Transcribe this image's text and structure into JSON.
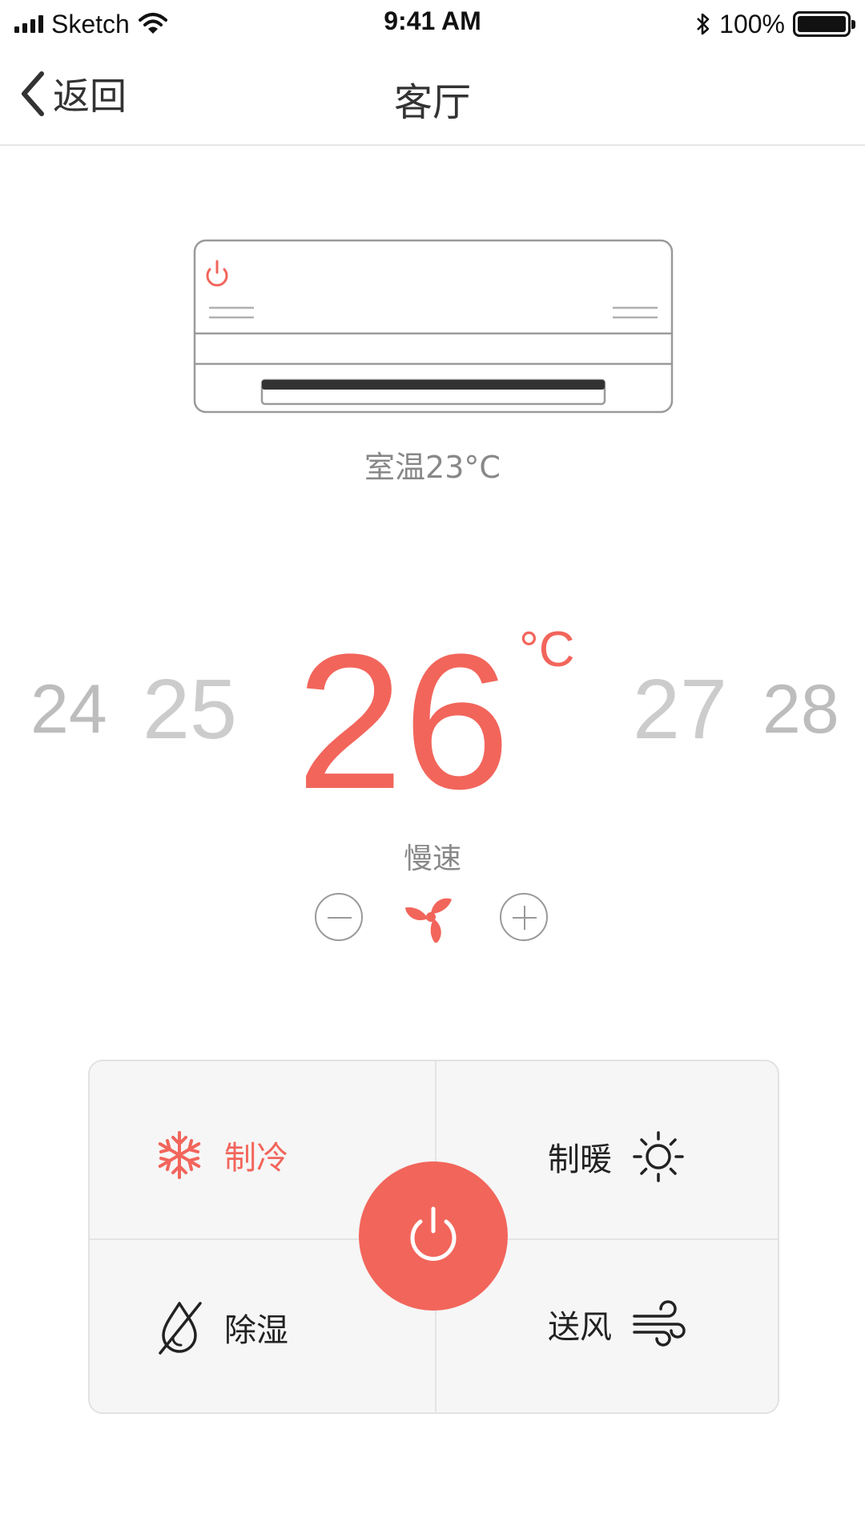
{
  "status_bar": {
    "carrier": "Sketch",
    "time": "9:41 AM",
    "battery": "100%"
  },
  "nav": {
    "back_label": "返回",
    "title": "客厅"
  },
  "room_temperature": "室温23°C",
  "temperature": {
    "options": [
      "24",
      "25",
      "26",
      "27",
      "28"
    ],
    "current": "26",
    "unit": "°C"
  },
  "fan": {
    "speed_label": "慢速"
  },
  "modes": {
    "cool": "制冷",
    "heat": "制暖",
    "dehumidify": "除湿",
    "fan": "送风",
    "active": "cool"
  },
  "colors": {
    "accent": "#f2655b",
    "inactive_number": "#c8c8c8",
    "panel_bg": "#f6f6f6"
  }
}
